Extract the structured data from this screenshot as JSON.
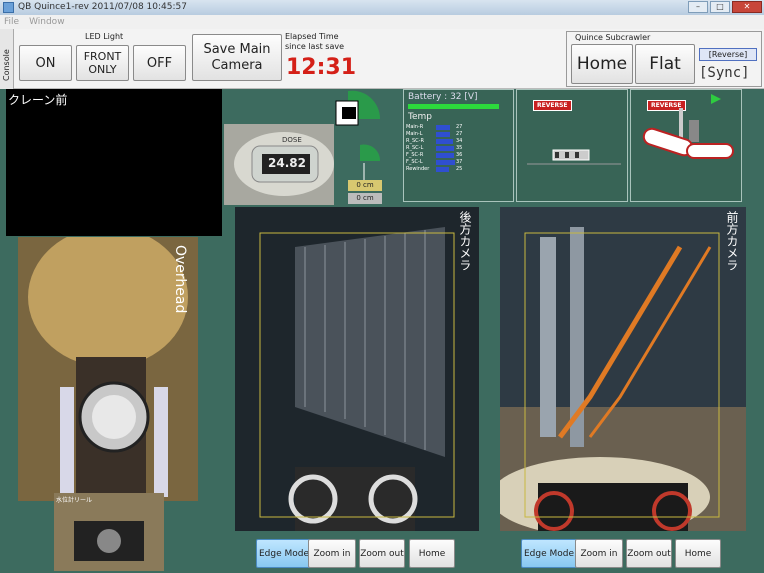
{
  "window": {
    "title": "QB Quince1-rev 2011/07/08 10:45:57"
  },
  "menu": {
    "file": "File",
    "window": "Window"
  },
  "toolbar": {
    "console_tab": "Console",
    "led_label": "LED Light",
    "on": "ON",
    "front_only": "FRONT ONLY",
    "off": "OFF",
    "save": "Save Main Camera",
    "elapsed_label": "Elapsed Time",
    "elapsed_sub": "since last save",
    "elapsed_value": "12:31",
    "subcrawler_label": "Quince Subcrawler",
    "home": "Home",
    "flat": "Flat",
    "reverse": "[Reverse]",
    "sync": "[Sync]"
  },
  "cameras": {
    "crane": "クレーン前",
    "overhead": "Overhead",
    "rear": "後方カメラ",
    "front": "前方カメラ",
    "small": "水位計リール",
    "meter_reading": "24.82",
    "meter_brand": "DOSE"
  },
  "distance": {
    "top": "0 cm",
    "bottom": "0 cm"
  },
  "status": {
    "battery_label": "Battery : 32 [V]",
    "battery_level": 0.95,
    "temp_label": "Temp",
    "temps": [
      {
        "name": "Main-R",
        "value": "27"
      },
      {
        "name": "Main-L",
        "value": "27"
      },
      {
        "name": "R_SC-R",
        "value": "34"
      },
      {
        "name": "R_SC-L",
        "value": "35"
      },
      {
        "name": "F_SC-R",
        "value": "36"
      },
      {
        "name": "F_SC-L",
        "value": "37"
      },
      {
        "name": "Rewinder",
        "value": "25"
      }
    ],
    "reverse_1": "REVERSE",
    "reverse_2": "REVERSE"
  },
  "cam_controls": {
    "edge": "Edge Mode",
    "zoom_in": "Zoom in",
    "zoom_out": "Zoom out",
    "home": "Home"
  },
  "colors": {
    "elapsed": "#d42018",
    "battery": "#2cd93c",
    "background": "#3d6b5f"
  }
}
